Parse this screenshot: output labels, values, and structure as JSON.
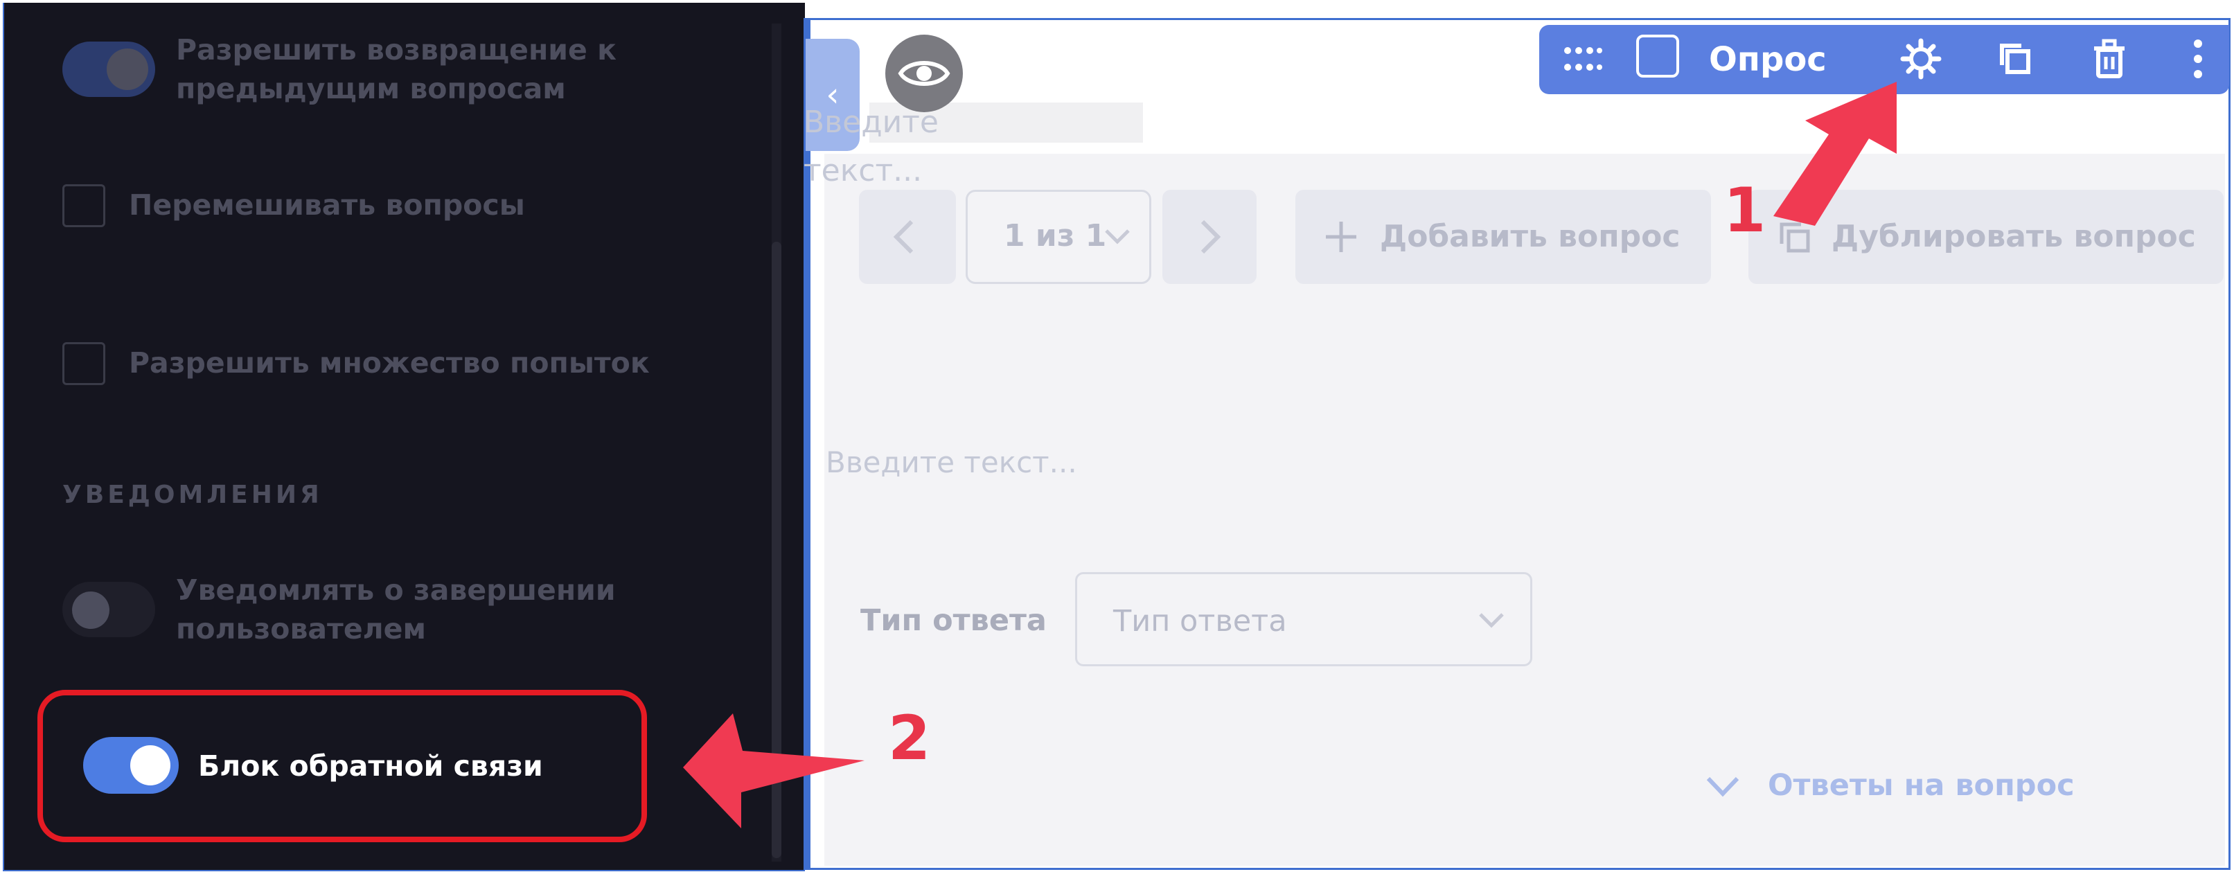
{
  "settings": {
    "options": [
      {
        "label_line1": "Разрешить возвращение к",
        "label_line2": "предыдущим вопросам",
        "control": "toggle",
        "state": "on-dim"
      },
      {
        "label": "Перемешивать вопросы",
        "control": "checkbox",
        "checked": false
      },
      {
        "label": "Разрешить множество попыток",
        "control": "checkbox",
        "checked": false
      }
    ],
    "notifications_section": "УВЕДОМЛЕНИЯ",
    "notify_option": {
      "label_line1": "Уведомлять о завершении",
      "label_line2": "пользователем",
      "control": "toggle",
      "state": "off"
    },
    "feedback_option": {
      "label": "Блок обратной связи",
      "control": "toggle",
      "state": "on"
    }
  },
  "toolbar": {
    "title": "Опрос",
    "icons": [
      "drag-handle-icon",
      "square-icon",
      "gear-icon",
      "duplicate-icon",
      "trash-icon",
      "more-vertical-icon"
    ]
  },
  "editor": {
    "title_placeholder": "Введите текст...",
    "pager": {
      "current": "1 из 1",
      "prev_icon": "chevron-left-icon",
      "next_icon": "chevron-right-icon"
    },
    "add_question_label": "Добавить вопрос",
    "duplicate_question_label": "Дублировать вопрос",
    "question_placeholder": "Введите текст...",
    "answer_type_label": "Тип ответа",
    "answer_type_value": "Тип ответа",
    "answers_toggle_label": "Ответы на вопрос"
  },
  "annotations": {
    "callout_1": "1",
    "callout_2": "2"
  },
  "colors": {
    "accent": "#5b7fe0",
    "panel_bg": "#15151f",
    "annotation_red": "#e8354a",
    "highlight_red": "#e51b24"
  }
}
